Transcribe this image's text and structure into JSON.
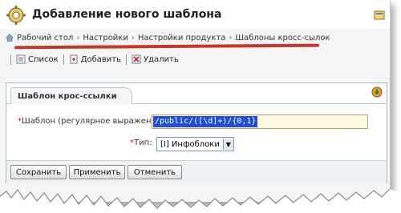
{
  "window": {
    "title": "Добавление нового шаблона"
  },
  "breadcrumb": {
    "items": [
      {
        "label": "Рабочий стол"
      },
      {
        "label": "Настройки"
      },
      {
        "label": "Настройки продукта"
      },
      {
        "label": "Шаблоны кросс-сылок"
      }
    ],
    "separator": "›"
  },
  "toolbar": {
    "list_label": "Список",
    "add_label": "Добавить",
    "delete_label": "Удалить"
  },
  "panel": {
    "tab_label": "Шаблон крос-ссылки"
  },
  "form": {
    "required_mark": "*",
    "pattern_label": "Шаблон (регулярное выражение):",
    "pattern_value": "/public/([\\d]+)/{0,1}",
    "type_label": "Тип:",
    "type_value": "[I] Инфоблоки"
  },
  "buttons": {
    "save_label": "Сохранить",
    "apply_label": "Применить",
    "cancel_label": "Отменить"
  },
  "colors": {
    "annotation_red": "#c0392b",
    "selection_blue": "#1e4fd6",
    "required_red": "#dd0000"
  }
}
